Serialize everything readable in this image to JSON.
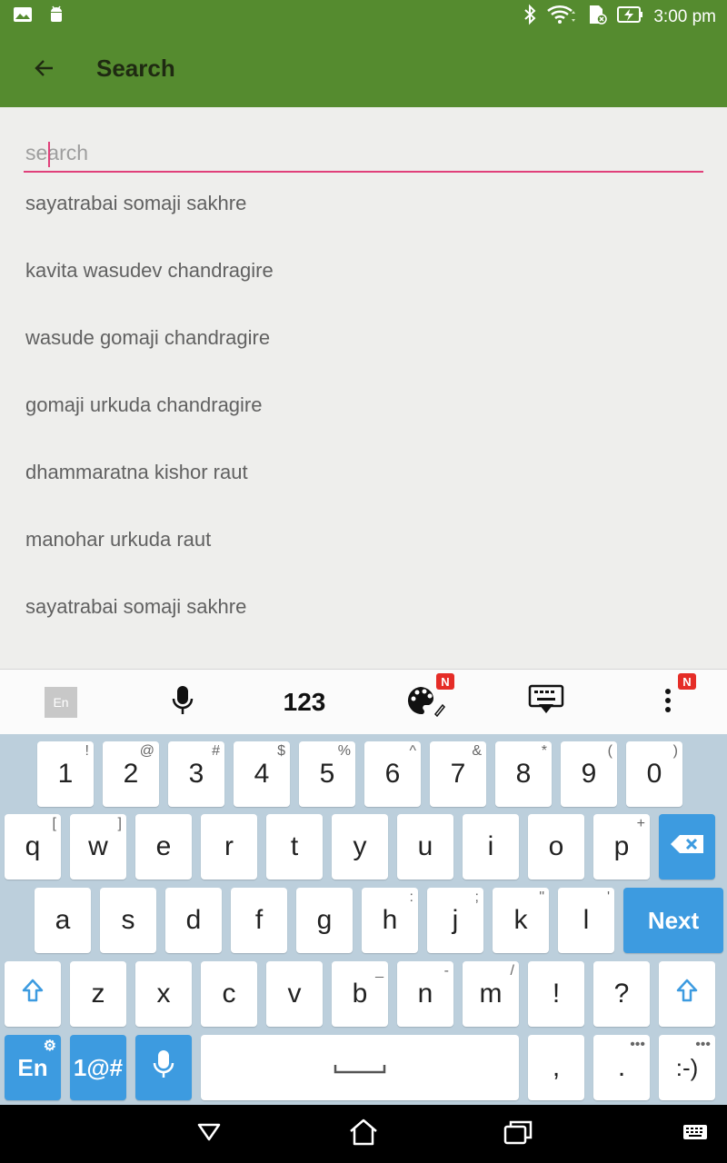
{
  "status_bar": {
    "time": "3:00 pm",
    "icons": [
      "image-icon",
      "android-debug-icon",
      "bluetooth-icon",
      "wifi-icon",
      "sdcard-icon",
      "battery-charging-icon"
    ]
  },
  "app_bar": {
    "title": "Search",
    "back_icon": "arrow-back-icon"
  },
  "search": {
    "placeholder": "search",
    "value": ""
  },
  "results": [
    "sayatrabai somaji sakhre",
    "kavita wasudev chandragire",
    "wasude gomaji chandragire",
    "gomaji urkuda chandragire",
    "dhammaratna kishor raut",
    "manohar urkuda raut",
    "sayatrabai somaji sakhre"
  ],
  "keyboard_toolbar": {
    "language": "En",
    "numbers_label": "123",
    "theme_badge": "N",
    "more_badge": "N"
  },
  "keyboard": {
    "row1": [
      [
        "1",
        "!"
      ],
      [
        "2",
        "@"
      ],
      [
        "3",
        "#"
      ],
      [
        "4",
        "$"
      ],
      [
        "5",
        "%"
      ],
      [
        "6",
        "^"
      ],
      [
        "7",
        "&"
      ],
      [
        "8",
        "*"
      ],
      [
        "9",
        "("
      ],
      [
        "0",
        ")"
      ]
    ],
    "row2": [
      [
        "q",
        "["
      ],
      [
        "w",
        "]"
      ],
      [
        "e",
        ""
      ],
      [
        "r",
        ""
      ],
      [
        "t",
        ""
      ],
      [
        "y",
        ""
      ],
      [
        "u",
        ""
      ],
      [
        "i",
        ""
      ],
      [
        "o",
        ""
      ],
      [
        "p",
        "+"
      ]
    ],
    "row3": [
      [
        "a",
        ""
      ],
      [
        "s",
        ""
      ],
      [
        "d",
        ""
      ],
      [
        "f",
        ""
      ],
      [
        "g",
        ""
      ],
      [
        "h",
        ":"
      ],
      [
        "j",
        ";"
      ],
      [
        "k",
        "\""
      ],
      [
        "l",
        "'"
      ]
    ],
    "row4": [
      [
        "z",
        ""
      ],
      [
        "x",
        ""
      ],
      [
        "c",
        ""
      ],
      [
        "v",
        ""
      ],
      [
        "b",
        "_"
      ],
      [
        "n",
        "-"
      ],
      [
        "m",
        "/"
      ],
      [
        "!",
        ""
      ],
      [
        "?",
        ""
      ]
    ],
    "next_label": "Next",
    "lang_label": "En",
    "symbols_label": "1@#",
    "comma": ",",
    "period": ".",
    "smiley": ":-)"
  },
  "nav_bar": {
    "icons": [
      "back-triangle-icon",
      "home-icon",
      "recents-icon",
      "keyboard-icon"
    ]
  },
  "colors": {
    "app_bar": "#558b2f",
    "accent": "#e0407a",
    "keyboard_bg": "#bccfdc",
    "key_blue": "#3d9be0"
  }
}
